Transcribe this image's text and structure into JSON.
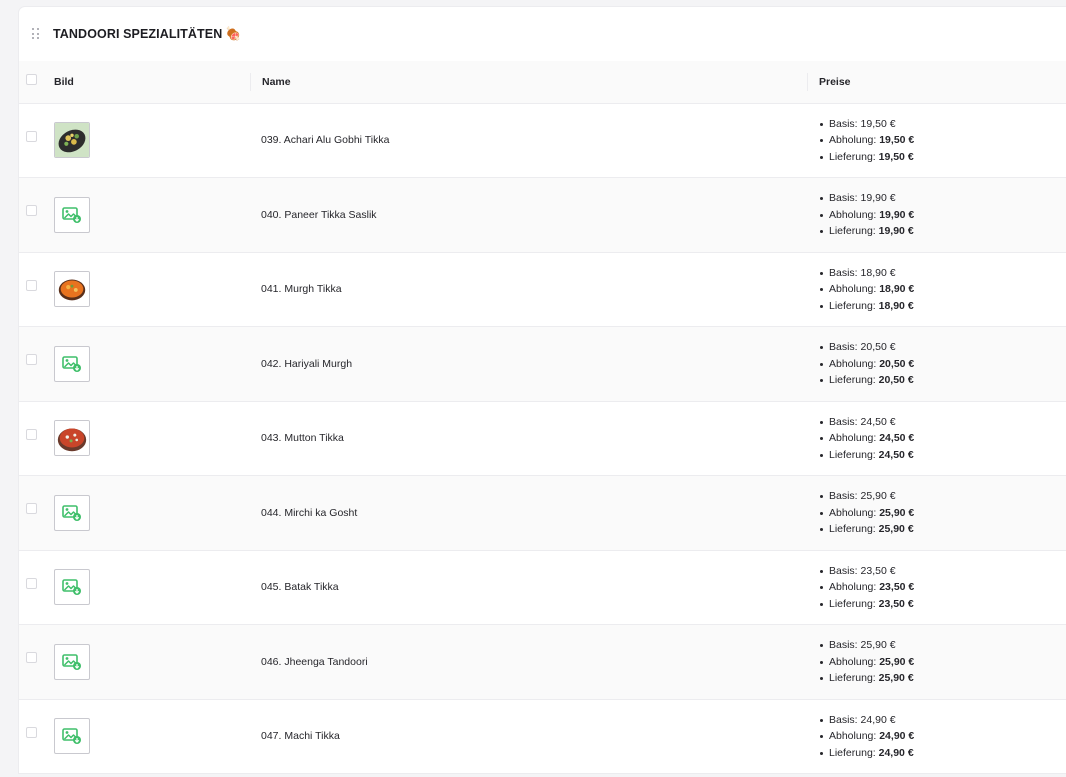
{
  "section": {
    "title": "TANDOORI SPEZIALITÄTEN",
    "emoji": "🍖"
  },
  "table": {
    "headers": {
      "image": "Bild",
      "name": "Name",
      "prices": "Preise"
    },
    "price_labels": {
      "base": "Basis:",
      "pickup": "Abholung:",
      "delivery": "Lieferung:"
    },
    "rows": [
      {
        "name": "039. Achari Alu Gobhi Tikka",
        "image": "photo-green-dish",
        "base": "19,50 €",
        "pickup": "19,50 €",
        "delivery": "19,50 €"
      },
      {
        "name": "040. Paneer Tikka Saslik",
        "image": "placeholder",
        "base": "19,90 €",
        "pickup": "19,90 €",
        "delivery": "19,90 €"
      },
      {
        "name": "041. Murgh Tikka",
        "image": "photo-orange-dish",
        "base": "18,90 €",
        "pickup": "18,90 €",
        "delivery": "18,90 €"
      },
      {
        "name": "042. Hariyali Murgh",
        "image": "placeholder",
        "base": "20,50 €",
        "pickup": "20,50 €",
        "delivery": "20,50 €"
      },
      {
        "name": "043. Mutton Tikka",
        "image": "photo-red-dish",
        "base": "24,50 €",
        "pickup": "24,50 €",
        "delivery": "24,50 €"
      },
      {
        "name": "044. Mirchi ka Gosht",
        "image": "placeholder",
        "base": "25,90 €",
        "pickup": "25,90 €",
        "delivery": "25,90 €"
      },
      {
        "name": "045. Batak Tikka",
        "image": "placeholder",
        "base": "23,50 €",
        "pickup": "23,50 €",
        "delivery": "23,50 €"
      },
      {
        "name": "046. Jheenga Tandoori",
        "image": "placeholder",
        "base": "25,90 €",
        "pickup": "25,90 €",
        "delivery": "25,90 €"
      },
      {
        "name": "047. Machi Tikka",
        "image": "placeholder",
        "base": "24,90 €",
        "pickup": "24,90 €",
        "delivery": "24,90 €"
      }
    ]
  },
  "colors": {
    "placeholder_icon": "#3fbf6a",
    "border": "#ececef",
    "zebra": "#fafafa"
  }
}
